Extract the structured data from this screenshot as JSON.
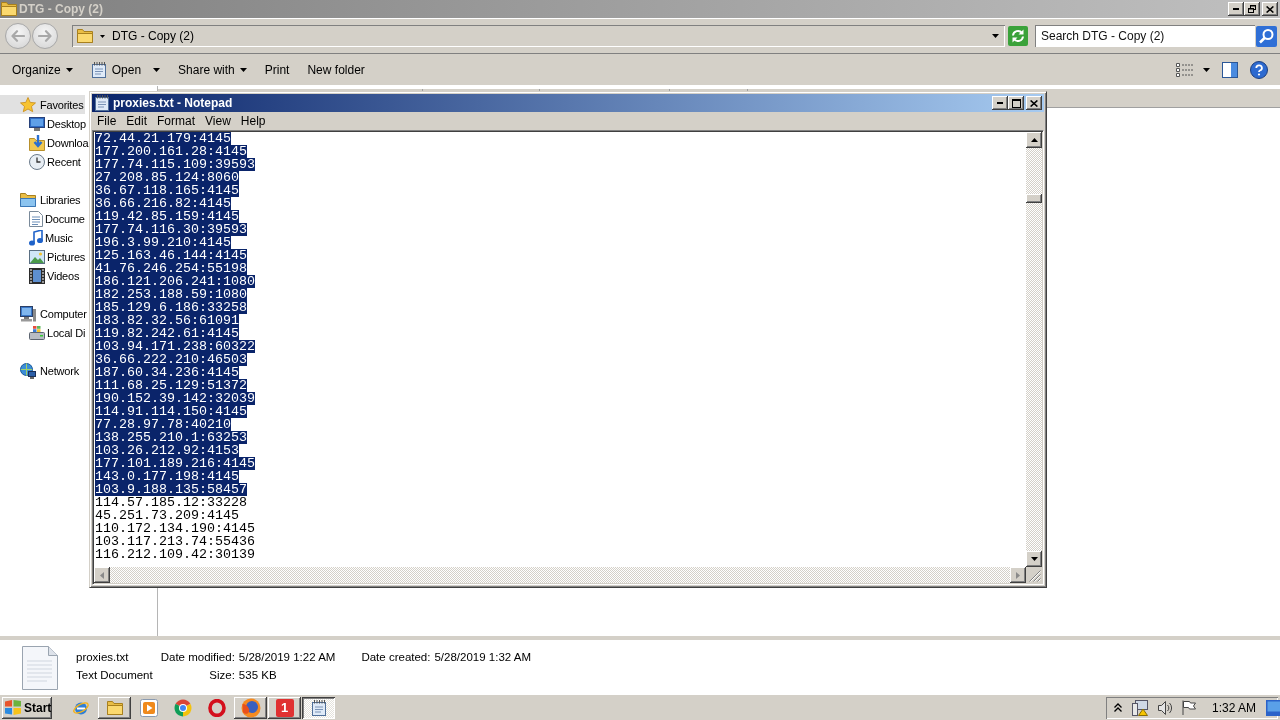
{
  "explorer": {
    "title": "DTG - Copy (2)",
    "history_buttons": [
      {
        "kind": "back",
        "disabled": true
      },
      {
        "kind": "forward",
        "disabled": true
      }
    ],
    "address": "DTG - Copy (2)",
    "search": {
      "placeholder": "Search DTG - Copy (2)"
    },
    "toolbar": [
      {
        "label": "Organize",
        "kind": "menu"
      },
      {
        "label": "Open",
        "kind": "split"
      },
      {
        "label": "Share with",
        "kind": "menu"
      },
      {
        "label": "Print",
        "kind": "plain"
      },
      {
        "label": "New folder",
        "kind": "plain"
      }
    ],
    "navigation": [
      {
        "label": "Favorites",
        "selected": true,
        "children": [
          {
            "label": "Desktop",
            "selected": false
          },
          {
            "label": "Downloa",
            "selected": false
          },
          {
            "label": "Recent",
            "selected": false
          }
        ]
      },
      {
        "label": "Libraries",
        "selected": false,
        "children": [
          {
            "label": "Docume",
            "selected": false
          },
          {
            "label": "Music",
            "selected": false
          },
          {
            "label": "Pictures",
            "selected": false
          },
          {
            "label": "Videos",
            "selected": false
          }
        ]
      },
      {
        "label": "Computer",
        "selected": false,
        "children": [
          {
            "label": "Local Di",
            "selected": false
          }
        ]
      },
      {
        "label": "Network",
        "selected": false
      }
    ],
    "details": {
      "name": "proxies.txt",
      "type": "Text Document",
      "fields": [
        {
          "label": "Date modified:",
          "value": "5/28/2019 1:22 AM"
        },
        {
          "label": "Date created:",
          "value": "5/28/2019 1:32 AM"
        },
        {
          "label": "Size:",
          "value": "535 KB"
        }
      ]
    }
  },
  "notepad": {
    "title": "proxies.txt - Notepad",
    "menu": [
      "File",
      "Edit",
      "Format",
      "View",
      "Help"
    ],
    "lines": [
      {
        "text": "72.44.21.179:4145",
        "selected": true
      },
      {
        "text": "177.200.161.28:4145",
        "selected": true
      },
      {
        "text": "177.74.115.109:39593",
        "selected": true
      },
      {
        "text": "27.208.85.124:8060",
        "selected": true
      },
      {
        "text": "36.67.118.165:4145",
        "selected": true
      },
      {
        "text": "36.66.216.82:4145",
        "selected": true
      },
      {
        "text": "119.42.85.159:4145",
        "selected": true
      },
      {
        "text": "177.74.116.30:39593",
        "selected": true
      },
      {
        "text": "196.3.99.210:4145",
        "selected": true
      },
      {
        "text": "125.163.46.144:4145",
        "selected": true
      },
      {
        "text": "41.76.246.254:55198",
        "selected": true
      },
      {
        "text": "186.121.206.241:1080",
        "selected": true
      },
      {
        "text": "182.253.188.59:1080",
        "selected": true
      },
      {
        "text": "185.129.6.186:33258",
        "selected": true
      },
      {
        "text": "183.82.32.56:61091",
        "selected": true
      },
      {
        "text": "119.82.242.61:4145",
        "selected": true
      },
      {
        "text": "103.94.171.238:60322",
        "selected": true
      },
      {
        "text": "36.66.222.210:46503",
        "selected": true
      },
      {
        "text": "187.60.34.236:4145",
        "selected": true
      },
      {
        "text": "111.68.25.129:51372",
        "selected": true
      },
      {
        "text": "190.152.39.142:32039",
        "selected": true
      },
      {
        "text": "114.91.114.150:4145",
        "selected": true
      },
      {
        "text": "77.28.97.78:40210",
        "selected": true
      },
      {
        "text": "138.255.210.1:63253",
        "selected": true
      },
      {
        "text": "103.26.212.92:4153",
        "selected": true
      },
      {
        "text": "177.101.189.216:4145",
        "selected": true
      },
      {
        "text": "143.0.177.198:4145",
        "selected": true
      },
      {
        "text": "103.9.188.135:58457",
        "selected": true
      },
      {
        "text": "114.57.185.12:33228",
        "selected": false
      },
      {
        "text": "45.251.73.209:4145",
        "selected": false
      },
      {
        "text": "110.172.134.190:4145",
        "selected": false
      },
      {
        "text": "103.117.213.74:55436",
        "selected": false
      },
      {
        "text": "116.212.109.42:30139",
        "selected": false
      }
    ]
  },
  "taskbar": {
    "start": "Start",
    "buttons": [
      {
        "kind": "pinned",
        "selected": false
      },
      {
        "kind": "running",
        "selected": false
      },
      {
        "kind": "pinned",
        "selected": false
      },
      {
        "kind": "pinned",
        "selected": false
      },
      {
        "kind": "pinned",
        "selected": false
      },
      {
        "kind": "running",
        "selected": false
      },
      {
        "kind": "running",
        "selected": false,
        "label": "1"
      },
      {
        "kind": "running",
        "selected": true
      }
    ],
    "clock": "1:32 AM"
  }
}
